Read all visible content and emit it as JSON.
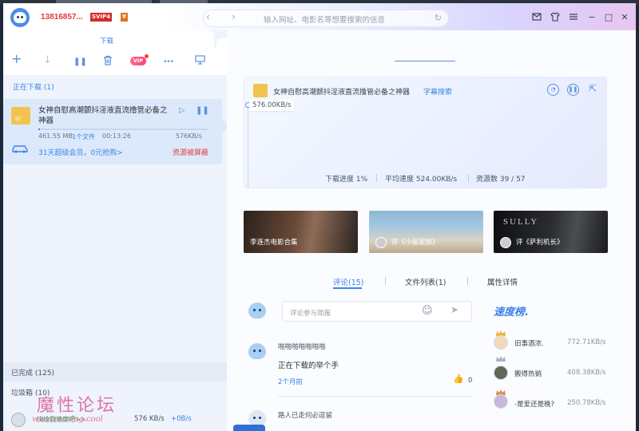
{
  "titlebar": {
    "username": "13816857...",
    "badge_svip": "SVIP4",
    "badge_yen": "¥",
    "address_placeholder": "输入网址、电影名等想要搜索的信息",
    "nav_back": "‹",
    "nav_forward": "›",
    "refresh": "↻",
    "btn_shirt": "👕",
    "btn_skin": "👔",
    "btn_min": "−",
    "btn_max": "□",
    "btn_close": "✕"
  },
  "left": {
    "tab_label": "下载",
    "toolbar": {
      "add": "+",
      "down": "↓",
      "pause": "❚❚",
      "delete": "🗑",
      "vip": "VIP",
      "more": "•••",
      "screen": "▭"
    },
    "downloading_header": "正在下载 (1)",
    "task": {
      "icon_text": "BT",
      "title": "女神自慰高潮颤抖淫液直流撸管必备之神器",
      "play": "▷",
      "pause": "❚❚",
      "progress_percent": 1,
      "size": "461.55 MB",
      "files": "1个文件",
      "time": "00:13:26",
      "speed": "576KB/s",
      "promo": "31天超级会员，0元抢购>",
      "blocked": "资源被屏蔽"
    },
    "completed": "已完成 (125)",
    "trash": "垃圾箱 (10)",
    "status": {
      "hint": "快给我速度吧>>",
      "down_speed": "576 KB/s",
      "up_speed": "+0B/s"
    },
    "watermark": "魔性论坛",
    "watermark_url": "www.moxing.cool"
  },
  "detail": {
    "title": "女神自慰高潮颤抖淫液直流撸管必备之神器",
    "subtitle_link": "字幕搜索",
    "btn_speed": "◔",
    "btn_pause": "❚❚",
    "btn_open": "⇱",
    "current_speed": "576.00KB/s",
    "stat_progress": "下载进度 1%",
    "stat_avg": "平均速度 524.00KB/s",
    "stat_resources": "资源数 39 / 57"
  },
  "cards": [
    {
      "label": "李连杰电影合集"
    },
    {
      "label": "评《小偷家族》"
    },
    {
      "label": "评《萨利机长》",
      "mark": "SULLY"
    }
  ],
  "tabs": {
    "comments": "评论(15)",
    "files": "文件列表(1)",
    "props": "属性详情"
  },
  "composer": {
    "placeholder": "评论参与简报",
    "emoji": "☺",
    "send": "➤"
  },
  "comments": [
    {
      "user": "啪啪啪啪啪啪啪",
      "text": "正在下载的举个手",
      "time": "2个月前",
      "likes": "0",
      "like_icon": "👍"
    },
    {
      "user": "路人已走何必逗留"
    }
  ],
  "ranking": {
    "title": "速度榜.",
    "items": [
      {
        "name": "旧事酒浓.",
        "speed": "772.71KB/s"
      },
      {
        "name": "搬得热销",
        "speed": "408.38KB/s"
      },
      {
        "name": "-是爱还是晚?",
        "speed": "250.78KB/s"
      }
    ]
  }
}
